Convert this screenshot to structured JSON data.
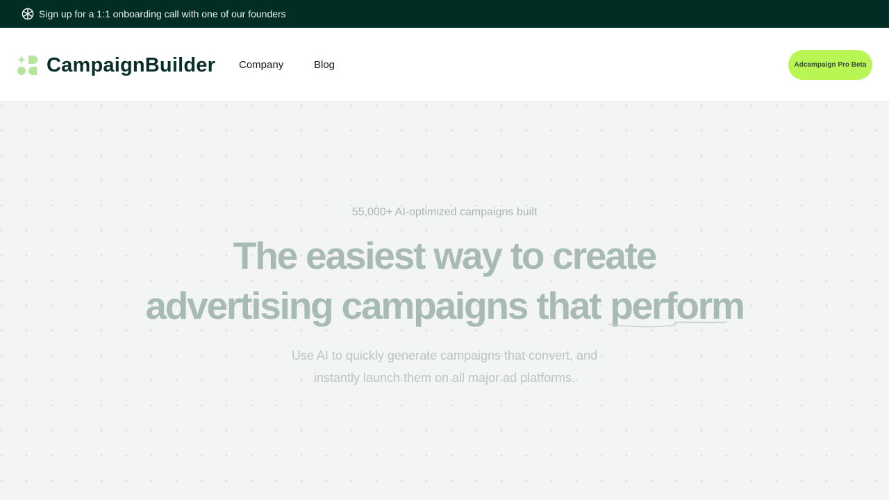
{
  "announcement": {
    "text": "Sign up for a 1:1 onboarding call with one of our founders",
    "icon": "starburst-icon"
  },
  "header": {
    "logo_text": "CampaignBuilder",
    "nav": [
      {
        "label": "Company"
      },
      {
        "label": "Blog"
      }
    ],
    "cta_label": "Adcampaign Pro Beta"
  },
  "hero": {
    "eyebrow": "55,000+ AI-optimized campaigns built",
    "headline_line1": "The easiest way to create",
    "headline_line2": "advertising campaigns that",
    "headline_highlight": "perform",
    "subheadline_line1": "Use AI to quickly generate campaigns that convert, and",
    "subheadline_line2": "instantly launch them on all major ad platforms."
  },
  "colors": {
    "announcement_bg": "#002e25",
    "brand_dark": "#072e27",
    "accent_lime": "#b9f553",
    "logo_mark": "#b5e59b",
    "hero_bg": "#f2f5f4"
  }
}
